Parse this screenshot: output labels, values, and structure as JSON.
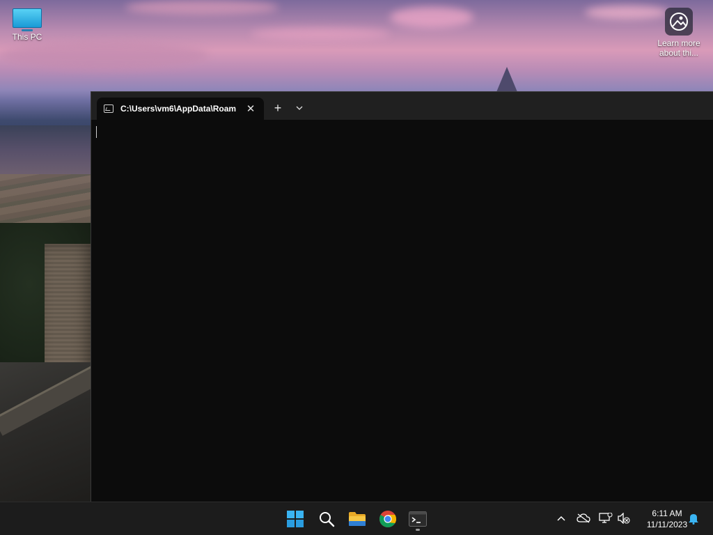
{
  "desktop": {
    "icons": [
      {
        "label": "This PC",
        "icon": "monitor-icon"
      },
      {
        "label": "Learn more about thi...",
        "label_line1": "Learn more",
        "label_line2": "about thi...",
        "icon": "learn-more-icon"
      }
    ]
  },
  "terminal": {
    "tab_title": "C:\\Users\\vm6\\AppData\\Roam",
    "tab_icon": "cmd-icon",
    "close_symbol": "✕",
    "new_tab_symbol": "+",
    "dropdown_icon": "chevron-down-icon",
    "background": "#0c0c0c",
    "titlebar_color": "#202020"
  },
  "taskbar": {
    "apps": [
      {
        "name": "start",
        "icon": "windows-logo-icon"
      },
      {
        "name": "search",
        "icon": "search-icon"
      },
      {
        "name": "file-explorer",
        "icon": "folder-icon"
      },
      {
        "name": "chrome",
        "icon": "chrome-icon"
      },
      {
        "name": "terminal",
        "icon": "terminal-icon",
        "active": true
      }
    ],
    "tray": [
      {
        "name": "show-hidden",
        "icon": "chevron-up-icon"
      },
      {
        "name": "onedrive",
        "icon": "cloud-off-icon"
      },
      {
        "name": "network",
        "icon": "network-icon"
      },
      {
        "name": "volume",
        "icon": "volume-muted-icon"
      }
    ],
    "clock": {
      "time": "6:11 AM",
      "date": "11/11/2023"
    },
    "notification_icon": "bell-icon"
  }
}
